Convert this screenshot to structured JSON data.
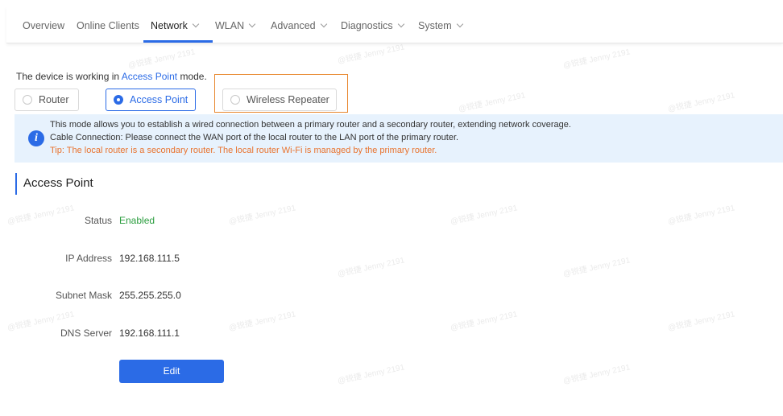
{
  "nav": {
    "items": [
      {
        "label": "Overview",
        "dropdown": false
      },
      {
        "label": "Online Clients",
        "dropdown": false
      },
      {
        "label": "Network",
        "dropdown": true,
        "active": true
      },
      {
        "label": "WLAN",
        "dropdown": true
      },
      {
        "label": "Advanced",
        "dropdown": true
      },
      {
        "label": "Diagnostics",
        "dropdown": true
      },
      {
        "label": "System",
        "dropdown": true
      }
    ]
  },
  "mode": {
    "prefix": "The device is working in ",
    "current": "Access Point",
    "suffix": " mode.",
    "options": [
      {
        "label": "Router",
        "selected": false
      },
      {
        "label": "Access Point",
        "selected": true
      },
      {
        "label": "Wireless Repeater",
        "selected": false
      }
    ]
  },
  "info": {
    "line1": "This mode allows you to establish a wired connection between a primary router and a secondary router, extending network coverage.",
    "line2": "Cable Connection: Please connect the WAN port of the local router to the LAN port of the primary router.",
    "tip": "Tip: The local router is a secondary router. The local router Wi-Fi is managed by the primary router."
  },
  "section": {
    "title": "Access Point",
    "fields": [
      {
        "label": "Status",
        "value": "Enabled"
      },
      {
        "label": "IP Address",
        "value": "192.168.111.5"
      },
      {
        "label": "Subnet Mask",
        "value": "255.255.255.0"
      },
      {
        "label": "DNS Server",
        "value": "192.168.111.1"
      }
    ],
    "edit_label": "Edit"
  },
  "watermark": "@锐捷 Jenny 2191",
  "colors": {
    "accent": "#2b6be6",
    "enabled": "#2a9d3e",
    "tip": "#e8732e",
    "highlight": "#e8872e",
    "info_bg": "#e7f2fd"
  }
}
